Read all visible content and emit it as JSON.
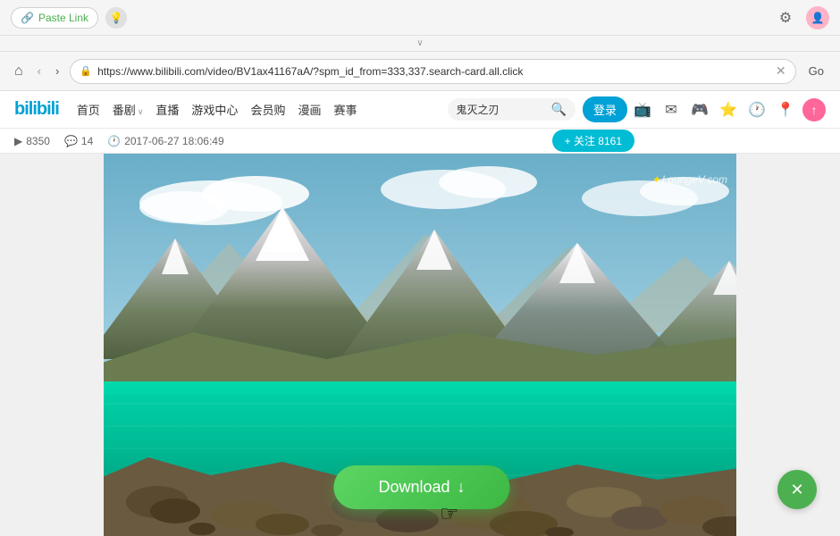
{
  "title_bar": {
    "paste_link_label": "Paste Link",
    "lightbulb_label": "💡",
    "gear_label": "⚙",
    "avatar_label": "👤"
  },
  "browser_bar": {
    "url": "https://www.bilibili.com/video/BV1ax41167aA/?spm_id_from=333,337.search-card.all.click",
    "go_label": "Go"
  },
  "bilibili": {
    "logo": "bilibili",
    "menu_items": [
      "首页",
      "番剧",
      "直播",
      "游戏中心",
      "会员购",
      "漫画",
      "赛事"
    ],
    "menu_dropdown": [
      "番剧"
    ],
    "search_placeholder": "鬼灭之刃",
    "login_label": "登录",
    "follow_label": "+ 关注 8161"
  },
  "video_meta": {
    "play_count": "8350",
    "comment_count": "14",
    "date": "2017-06-27 18:06:49"
  },
  "watermark": {
    "star": "✦",
    "text": "LoungeV.com"
  },
  "download_button": {
    "label": "Download",
    "arrow": "↓"
  },
  "close_button": {
    "label": "✕"
  },
  "collapse": {
    "chevron": "∨"
  }
}
